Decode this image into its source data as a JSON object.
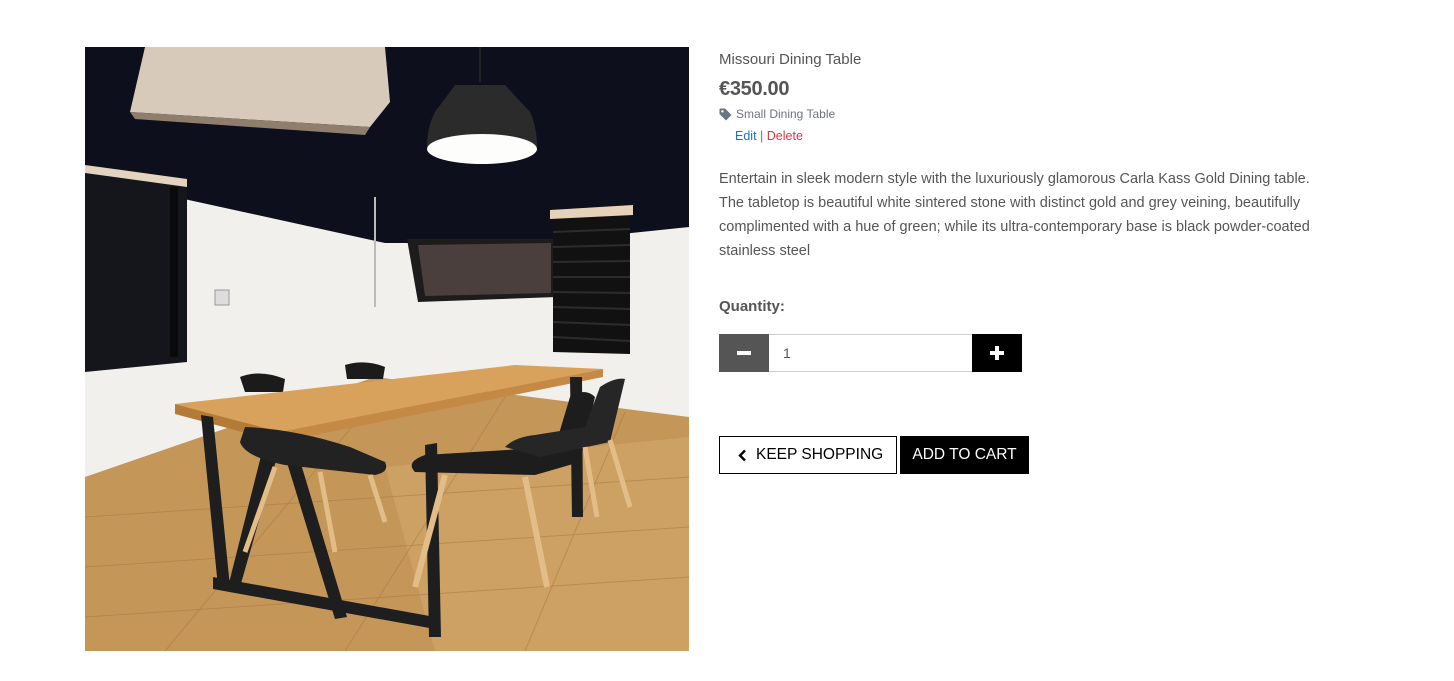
{
  "product": {
    "image_alt": "Missouri Dining Table",
    "name": "Missouri Dining Table",
    "price": "€350.00",
    "category": {
      "icon": "tag-icon",
      "label": "Small Dining Table"
    },
    "admin": {
      "edit_label": "Edit",
      "separator": "|",
      "delete_label": "Delete"
    },
    "description": "Entertain in sleek modern style with the luxuriously glamorous Carla Kass Gold Dining table. The tabletop is beautiful white sintered stone with distinct gold and grey veining, beautifully complimented with a hue of green; while its ultra-contemporary base is black powder-coated stainless steel"
  },
  "quantity": {
    "label": "Quantity:",
    "value": "1",
    "decrement_icon": "minus-icon",
    "increment_icon": "plus-icon"
  },
  "actions": {
    "keep_shopping_label": "KEEP SHOPPING",
    "keep_shopping_icon": "chevron-left-icon",
    "add_to_cart_label": "ADD TO CART"
  },
  "colors": {
    "text": "#555555",
    "edit_link": "#1a73c8",
    "delete_link": "#dc3545",
    "button_dark": "#000000",
    "button_muted": "#555555"
  }
}
